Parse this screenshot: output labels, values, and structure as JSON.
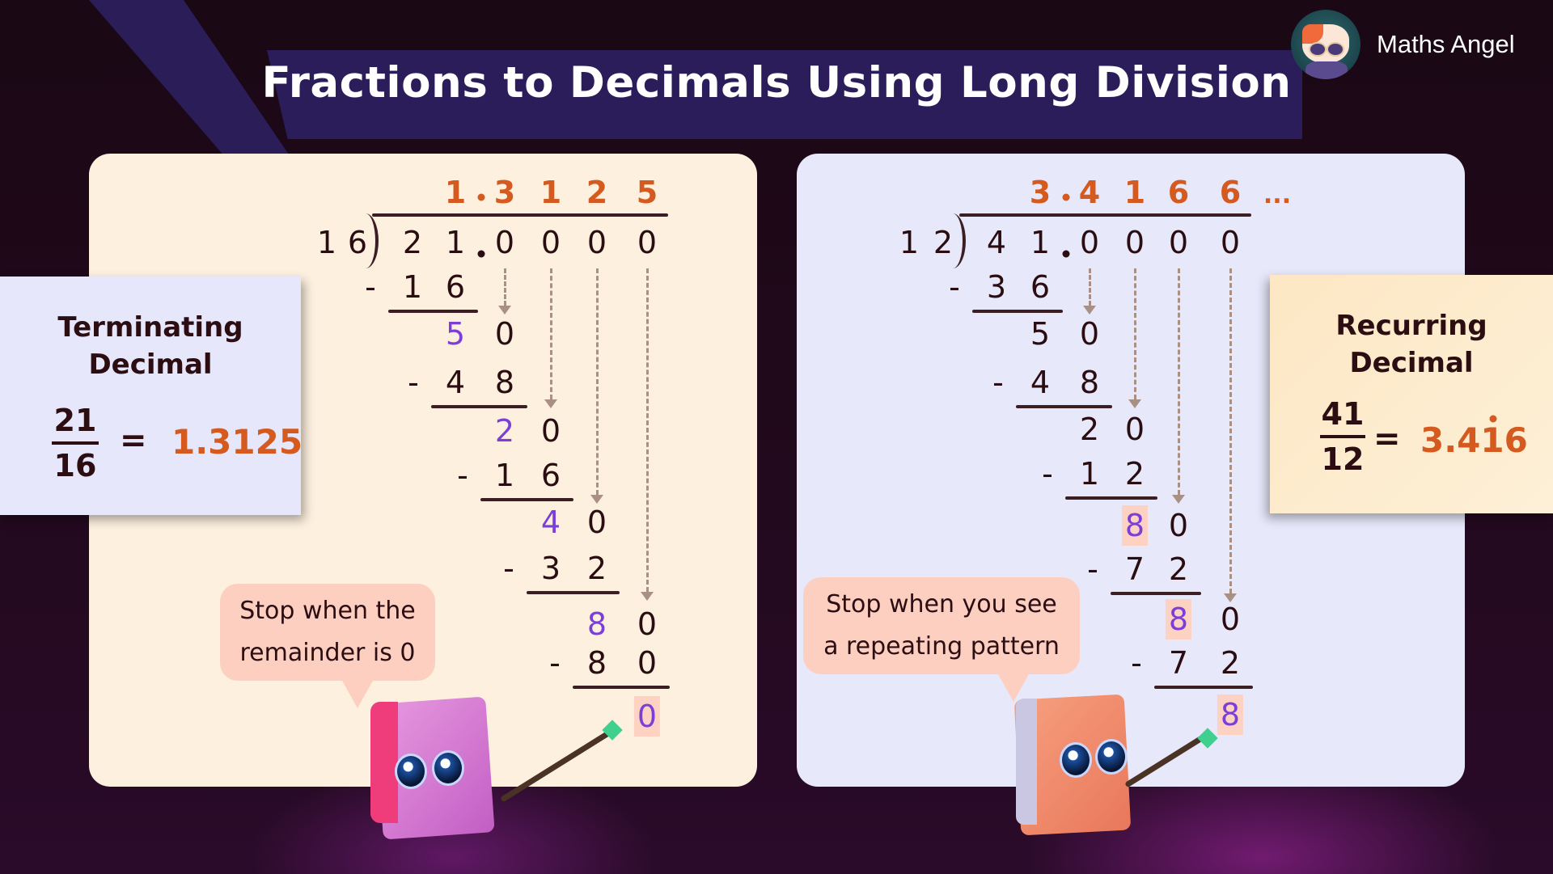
{
  "header": {
    "title": "Fractions to Decimals Using Long Division",
    "brand_name": "Maths Angel",
    "brand_logo_icon": "cat-mascot-logo-icon"
  },
  "colors": {
    "quotient": "#d45a1f",
    "remainder": "#7b3fd8",
    "highlight": "#fdd2c2",
    "ink": "#2a0d10",
    "left_panel": "#fdf0df",
    "right_panel": "#e8e8fb"
  },
  "left": {
    "note": {
      "title_line1": "Terminating",
      "title_line2": "Decimal",
      "numerator": "21",
      "denominator": "16",
      "equals": "=",
      "result": "1.3125"
    },
    "division": {
      "divisor": [
        "1",
        "6"
      ],
      "dividend": [
        "2",
        "1",
        "0",
        "0",
        "0",
        "0"
      ],
      "quotient": [
        "1",
        "3",
        "1",
        "2",
        "5"
      ],
      "steps": [
        {
          "minus": "-",
          "digits": [
            "1",
            "6"
          ]
        },
        {
          "digits": [
            "5",
            "0"
          ]
        },
        {
          "minus": "-",
          "digits": [
            "4",
            "8"
          ]
        },
        {
          "digits": [
            "2",
            "0"
          ]
        },
        {
          "minus": "-",
          "digits": [
            "1",
            "6"
          ]
        },
        {
          "digits": [
            "4",
            "0"
          ]
        },
        {
          "minus": "-",
          "digits": [
            "3",
            "2"
          ]
        },
        {
          "digits": [
            "8",
            "0"
          ]
        },
        {
          "minus": "-",
          "digits": [
            "8",
            "0"
          ]
        },
        {
          "digits": [
            "0"
          ]
        }
      ]
    },
    "bubble": {
      "line1": "Stop when the",
      "line2": "remainder is 0"
    }
  },
  "right": {
    "note": {
      "title_line1": "Recurring",
      "title_line2": "Decimal",
      "numerator": "41",
      "denominator": "12",
      "equals": "=",
      "result": "3.416",
      "recurring_digit": "6"
    },
    "division": {
      "divisor": [
        "1",
        "2"
      ],
      "dividend": [
        "4",
        "1",
        "0",
        "0",
        "0",
        "0"
      ],
      "quotient": [
        "3",
        "4",
        "1",
        "6",
        "6"
      ],
      "ellipsis": "...",
      "steps": [
        {
          "minus": "-",
          "digits": [
            "3",
            "6"
          ]
        },
        {
          "digits": [
            "5",
            "0"
          ]
        },
        {
          "minus": "-",
          "digits": [
            "4",
            "8"
          ]
        },
        {
          "digits": [
            "2",
            "0"
          ]
        },
        {
          "minus": "-",
          "digits": [
            "1",
            "2"
          ]
        },
        {
          "digits": [
            "8",
            "0"
          ]
        },
        {
          "minus": "-",
          "digits": [
            "7",
            "2"
          ]
        },
        {
          "digits": [
            "8",
            "0"
          ]
        },
        {
          "minus": "-",
          "digits": [
            "7",
            "2"
          ]
        },
        {
          "digits": [
            "8"
          ]
        }
      ]
    },
    "bubble": {
      "line1": "Stop when you see",
      "line2": "a repeating pattern"
    }
  }
}
